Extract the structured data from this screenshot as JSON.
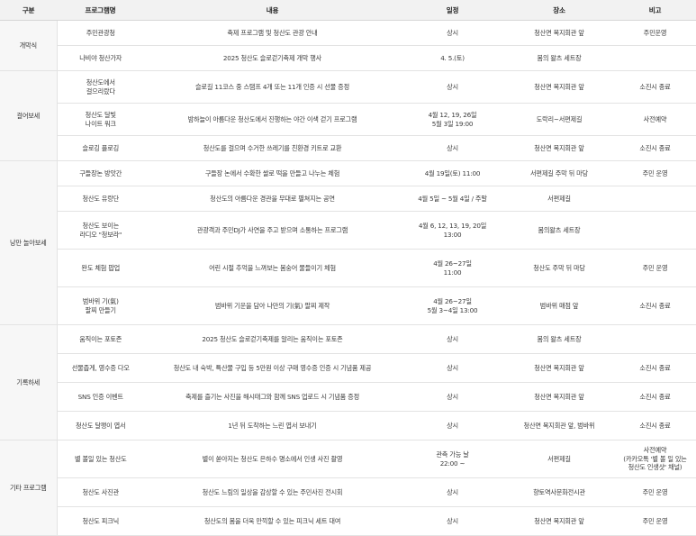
{
  "headers": {
    "category": "구분",
    "program": "프로그램명",
    "content": "내용",
    "schedule": "일정",
    "place": "장소",
    "note": "비고"
  },
  "groups": [
    {
      "category": "개막식",
      "rows": [
        {
          "program": "주민관광청",
          "content": "축제 프로그램 및 청산도 관광 안내",
          "schedule": "상시",
          "place": "청산면 복지회관 앞",
          "note": "주민운영"
        },
        {
          "program": "나비야 청산가자",
          "content": "2025 청산도 슬로걷기축제 개막 행사",
          "schedule": "4. 5.(토)",
          "place": "봄의 왈츠 세트장",
          "note": ""
        }
      ]
    },
    {
      "category": "걸어보세",
      "rows": [
        {
          "program": "청산도에서\n걸으리랐다",
          "content": "슬로길 11코스 중 스탬프 4개 또는 11개 인증 시 선물 증정",
          "schedule": "상시",
          "place": "청산면 복지회관 앞",
          "note": "소진시 종료"
        },
        {
          "program": "청산도 달빛\n나이트 워크",
          "content": "밤하늘이 아름다운 청산도에서 진행하는 야간 이색 걷기 프로그램",
          "schedule": "4월 12, 19, 26일\n5월 3일 19:00",
          "place": "도락리~서편제길",
          "note": "사전예약"
        },
        {
          "program": "슬로깅 플로깅",
          "content": "청산도를 걸으며 수거한 쓰레기를 친환경 키트로 교환",
          "schedule": "상시",
          "place": "청산면 복지회관 앞",
          "note": "소진시 종료"
        }
      ]
    },
    {
      "category": "낭만 놀아보세",
      "rows": [
        {
          "program": "구들장논 방앗간",
          "content": "구들장 논에서 수확한 쌀로 떡을 만들고 나누는 체험",
          "schedule": "4월 19일(토) 11:00",
          "place": "서편제길 주막 뒤 마당",
          "note": "주민 운영"
        },
        {
          "program": "청산도 유랑단",
          "content": "청산도의 아름다운 경관을 무대로 펼쳐지는 공연",
          "schedule": "4월 5일 ~ 5월 4일 / 주말",
          "place": "서편제길",
          "note": ""
        },
        {
          "program": "청산도 보이는\n라디오 \"청보라\"",
          "content": "관광객과 주민DJ가 사연을 주고 받으며 소통하는 프로그램",
          "schedule": "4월 6, 12, 13, 19, 20일\n13:00",
          "place": "봄의왈츠 세트장",
          "note": ""
        },
        {
          "program": "완도 체험 팝업",
          "content": "어린 시절 추억을 느껴보는 봄숭어 물들이기 체험",
          "schedule": "4월 26~27일\n11:00",
          "place": "청산도 주막 뒤 마당",
          "note": "주민 운영"
        },
        {
          "program": "범바위 기(氣)\n팔찌 만들기",
          "content": "범바위 기운을 담아 나만의 기(氣) 팔찌 제작",
          "schedule": "4월 26~27일\n5월 3~4일 13:00",
          "place": "범바위 매점 앞",
          "note": "소진시 종료"
        }
      ]
    },
    {
      "category": "기록하세",
      "rows": [
        {
          "program": "움직이는 포토존",
          "content": "2025 청산도 슬로걷기축제를 알리는 움직이는 포토존",
          "schedule": "상시",
          "place": "봄의 왈츠 세트장",
          "note": ""
        },
        {
          "program": "선물줍게, 영수증 다오",
          "content": "청산도 내 숙박, 특산물 구입 등 5만원 이상 구매 영수증 인증 시 기념품 제공",
          "schedule": "상시",
          "place": "청산면 복지회관 앞",
          "note": "소진시 종료"
        },
        {
          "program": "SNS 인증 이벤트",
          "content": "축제를 즐기는 사진을 해시태그와 함께 SNS 업로드 시 기념품 증정",
          "schedule": "상시",
          "place": "청산면 복지회관 앞",
          "note": "소진시 종료"
        },
        {
          "program": "청산도 달팽이 엽서",
          "content": "1년 뒤 도착하는 느린 엽서 보내기",
          "schedule": "상시",
          "place": "청산면 복지회관 앞, 범바위",
          "note": "소진시 종료"
        }
      ]
    },
    {
      "category": "기타 프로그램",
      "rows": [
        {
          "program": "별 볼일 있는 청산도",
          "content": "별이 쏟아지는 청산도 은하수 명소에서 인생 사진 촬영",
          "schedule": "관측 가능 날\n22:00 ~",
          "place": "서편제길",
          "note": "사전예약\n(카카오톡 '별 볼 일 있는 청산도 인생샷' 채널)"
        },
        {
          "program": "청산도 사진관",
          "content": "청산도 느림의 일상을 감상할 수 있는 주민사진 전시회",
          "schedule": "상시",
          "place": "향토역사문화전시관",
          "note": "주민 운영"
        },
        {
          "program": "청산도 피크닉",
          "content": "청산도의 봄을 더욱 만끽할 수 있는 피크닉 세트 대여",
          "schedule": "상시",
          "place": "청산면 복지회관 앞",
          "note": "주민 운영"
        }
      ]
    }
  ]
}
